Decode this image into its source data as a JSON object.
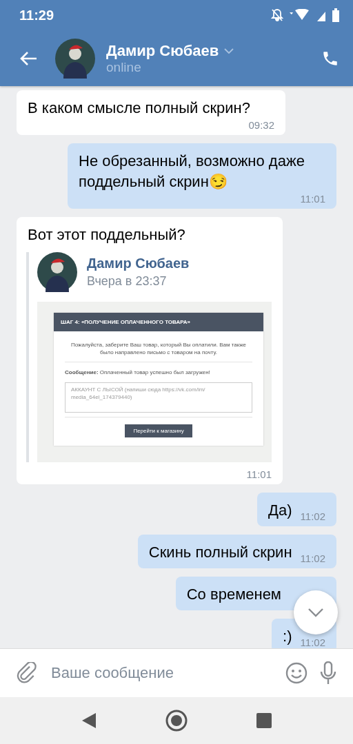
{
  "status_bar": {
    "time": "11:29"
  },
  "header": {
    "name": "Дамир Сюбаев",
    "status": "online"
  },
  "messages": [
    {
      "kind": "text",
      "outgoing": false,
      "text": "В каком смысле полный скрин?",
      "time": "09:32"
    },
    {
      "kind": "text",
      "outgoing": true,
      "text": "Не обрезанный, возможно даже поддельный скрин😏",
      "time": "11:01"
    },
    {
      "kind": "repost",
      "outgoing": false,
      "text": "Вот этот поддельный?",
      "time": "11:01",
      "repost": {
        "author": "Дамир Сюбаев",
        "date": "Вчера в 23:37",
        "screenshot": {
          "heading": "ШАГ 4: «ПОЛУЧЕНИЕ ОПЛАЧЕННОГО ТОВАРА»",
          "notice": "Пожалуйста, заберите Ваш товар, который Вы оплатили. Вам также было направлено письмо с товаром на почту.",
          "message_label": "Сообщение:",
          "message": "Оплаченный товар успешно был загружен!",
          "textarea": "АККАУНТ С ЛЫСОЙ (напиши сюда https://vk.com/im/ media_64el_174379440)",
          "button": "Перейти к магазину"
        }
      }
    },
    {
      "kind": "text",
      "outgoing": true,
      "text": "Да)",
      "time": "11:02"
    },
    {
      "kind": "text",
      "outgoing": true,
      "text": "Скинь полный скрин",
      "time": "11:02"
    },
    {
      "kind": "text",
      "outgoing": true,
      "text": "Со временем"
    },
    {
      "kind": "text",
      "outgoing": true,
      "text": ":)",
      "time": "11:02"
    }
  ],
  "composer": {
    "placeholder": "Ваше сообщение"
  }
}
